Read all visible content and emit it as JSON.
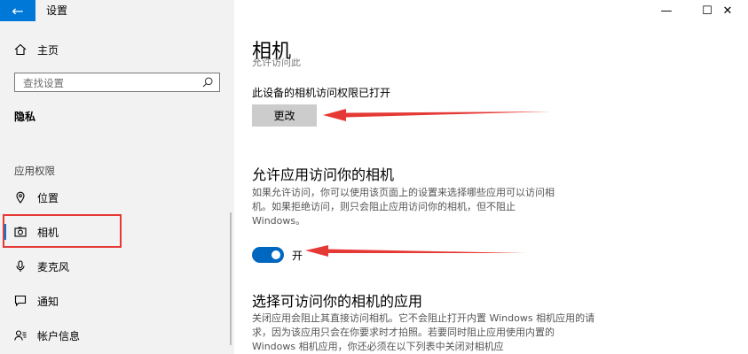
{
  "window": {
    "title": "设置",
    "back_glyph": "←",
    "minimize_glyph": "—",
    "maximize_glyph": "☐",
    "close_glyph": "✕"
  },
  "sidebar": {
    "home_label": "主页",
    "search_placeholder": "查找设置",
    "section_title": "隐私",
    "group_label": "应用权限",
    "items": [
      {
        "label": "位置",
        "icon": "location-icon"
      },
      {
        "label": "相机",
        "icon": "camera-icon",
        "selected": true
      },
      {
        "label": "麦克风",
        "icon": "microphone-icon"
      },
      {
        "label": "通知",
        "icon": "notification-icon"
      },
      {
        "label": "帐户信息",
        "icon": "account-info-icon"
      }
    ],
    "accent_color": "#0078d7"
  },
  "main": {
    "title": "相机",
    "clipped_text": "允许访问此",
    "device_access_status": "此设备的相机访问权限已打开",
    "change_button": "更改",
    "allow_apps_heading": "允许应用访问你的相机",
    "allow_apps_desc": "如果允许访问，你可以使用该页面上的设置来选择哪些应用可以访问相机。如果拒绝访问，则只会阻止应用访问你的相机，但不阻止 Windows。",
    "toggle_state_label": "开",
    "toggle_on": true,
    "choose_apps_heading": "选择可访问你的相机的应用",
    "choose_apps_desc": "关闭应用会阻止其直接访问相机。它不会阻止打开内置 Windows 相机应用的请求，因为该应用只会在你要求时才拍照。若要同时阻止应用使用内置的 Windows 相机应用，你还必须在以下列表中关闭对相机应"
  },
  "annotation_color": "#e53935"
}
